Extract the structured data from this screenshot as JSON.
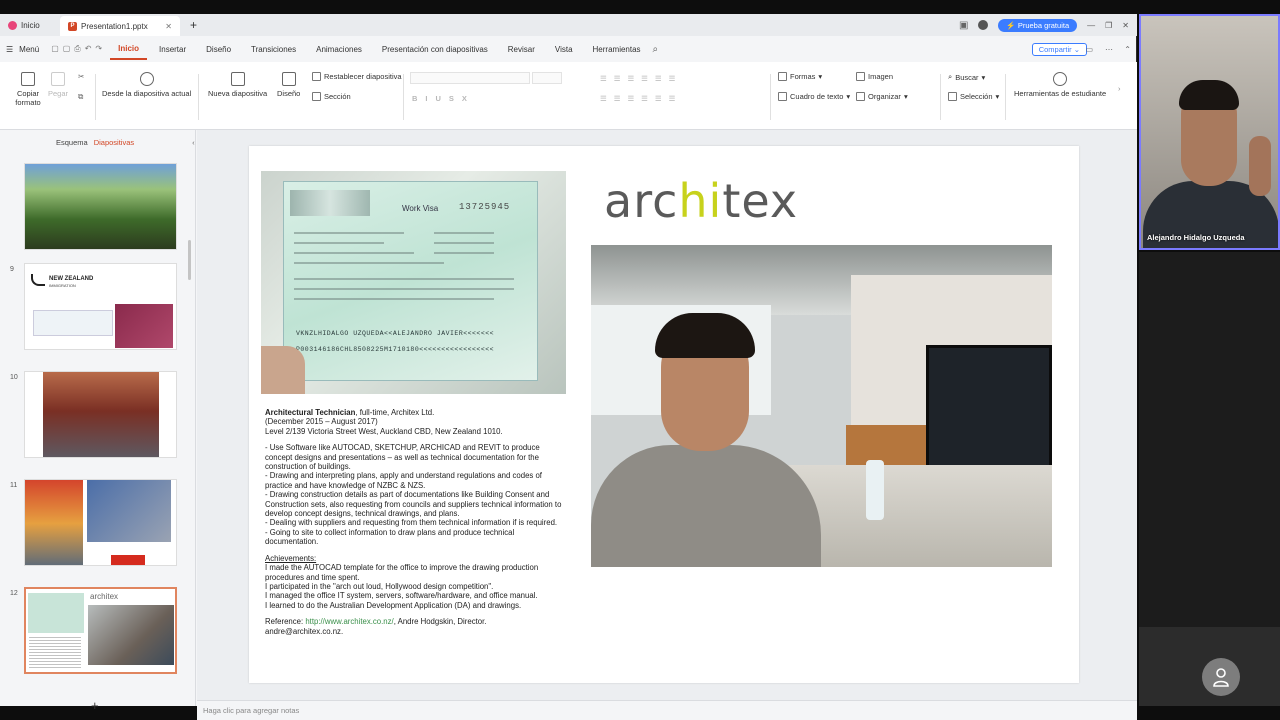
{
  "titlebar": {
    "home_tab": "Inicio",
    "doc_tab": "Presentation1.pptx",
    "trial": "Prueba gratuita"
  },
  "menu": {
    "menu_label": "Menú",
    "items": [
      "Inicio",
      "Insertar",
      "Diseño",
      "Transiciones",
      "Animaciones",
      "Presentación con diapositivas",
      "Revisar",
      "Vista",
      "Herramientas"
    ],
    "share": "Compartir"
  },
  "ribbon": {
    "copy_format": "Copiar formato",
    "paste": "Pegar",
    "from_slide": "Desde la diapositiva actual",
    "new_slide": "Nueva diapositiva",
    "layout": "Diseño",
    "reset_slide": "Restablecer diapositiva",
    "section": "Sección",
    "shapes": "Formas",
    "image": "Imagen",
    "find": "Buscar",
    "textbox": "Cuadro de texto",
    "arrange": "Organizar",
    "select": "Selección",
    "student_tools": "Herramientas de estudiante"
  },
  "leftpanel": {
    "outline_tab": "Esquema",
    "slides_tab": "Diapositivas",
    "slide_numbers": [
      "9",
      "10",
      "11",
      "12"
    ],
    "thumb_nz": "NEW ZEALAND",
    "thumb_nz_sub": "IMMIGRATION",
    "thumb_architex": "architex"
  },
  "slide": {
    "brand_pre": "arc",
    "brand_hl": "hi",
    "brand_post": "tex",
    "visa": {
      "title": "Work Visa",
      "number": "13725945",
      "mrz1": "VKNZLHIDALGO UZQUEDA<<ALEJANDRO JAVIER<<<<<<<",
      "mrz2": "P003146186CHL8508225M1710180<<<<<<<<<<<<<<<<<"
    },
    "job_title": "Architectural Technician",
    "job_rest": ", full-time, Architex Ltd.",
    "dates": "(December 2015 – August 2017)",
    "address": "Level 2/139 Victoria Street West, Auckland CBD, New Zealand 1010.",
    "duties": [
      "- Use Software like AUTOCAD, SKETCHUP, ARCHICAD and REVIT to produce concept designs and presentations – as well as technical documentation for the construction of buildings.",
      "- Drawing and interpreting plans, apply and understand regulations and codes of practice and have knowledge of NZBC & NZS.",
      "- Drawing construction details as part of documentations like Building Consent and Construction sets, also requesting from councils and suppliers technical information to develop concept designs, technical drawings, and plans.",
      "- Dealing with suppliers and requesting from them technical information if is required.",
      "- Going to site to collect information to draw plans and produce technical documentation."
    ],
    "achievements_label": "Achievements:",
    "achievements": [
      "I made the AUTOCAD template for the office to improve the drawing production procedures and time spent.",
      "I participated in the \"arch out loud, Hollywood design competition\".",
      "I managed the office IT system, servers, software/hardware, and office manual.",
      "I learned to do the Australian Development Application (DA) and drawings."
    ],
    "reference_label": "Reference: ",
    "reference_link": "http://www.architex.co.nz/",
    "reference_rest": ", Andre Hodgskin, Director. andre@architex.co.nz."
  },
  "notes_placeholder": "Haga clic para agregar notas",
  "video": {
    "participant": "Alejandro Hidalgo Uzqueda"
  },
  "colors": {
    "accent": "#d24726",
    "brand_green": "#c7d21c",
    "trial_blue": "#3b7cff"
  }
}
